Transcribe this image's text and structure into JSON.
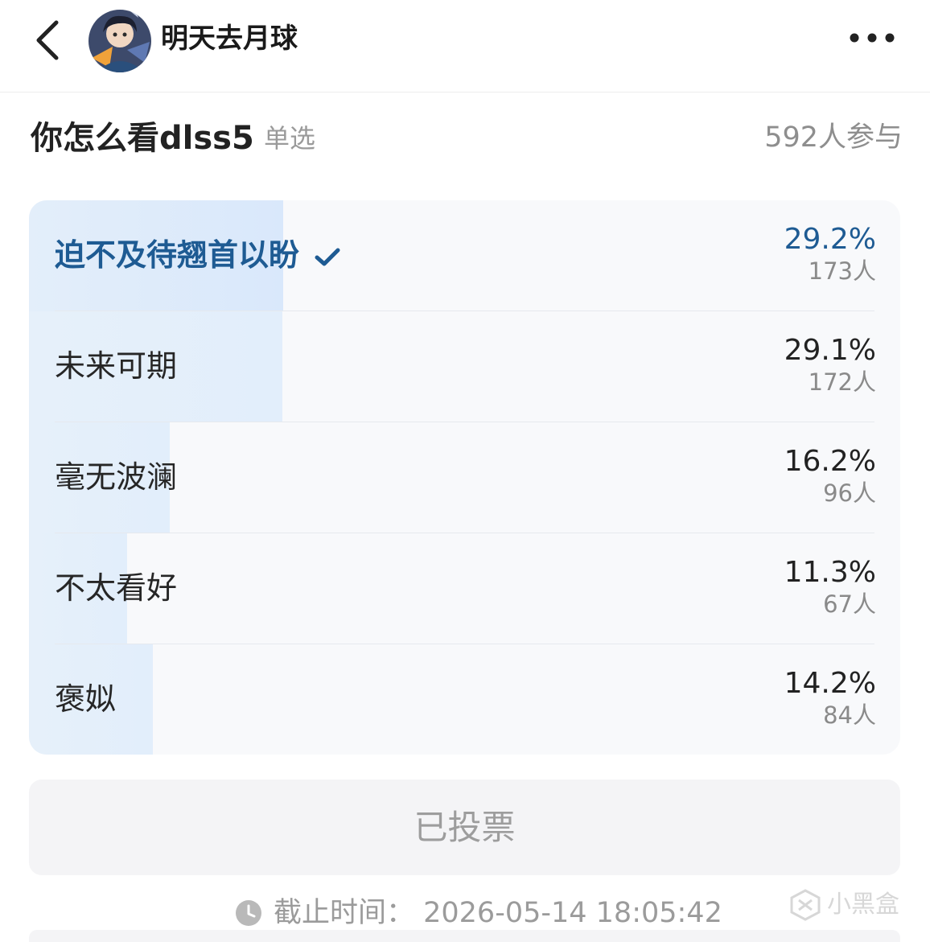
{
  "header": {
    "username": "明天去月球"
  },
  "poll": {
    "title": "你怎么看dlss5",
    "type": "单选",
    "participants": "592人参与",
    "options": [
      {
        "label": "迫不及待翘首以盼",
        "percent": "29.2%",
        "count": "173人",
        "fraction": 0.292,
        "selected": true
      },
      {
        "label": "未来可期",
        "percent": "29.1%",
        "count": "172人",
        "fraction": 0.291,
        "selected": false
      },
      {
        "label": "毫无波澜",
        "percent": "16.2%",
        "count": "96人",
        "fraction": 0.162,
        "selected": false
      },
      {
        "label": "不太看好",
        "percent": "11.3%",
        "count": "67人",
        "fraction": 0.113,
        "selected": false
      },
      {
        "label": "褒姒",
        "percent": "14.2%",
        "count": "84人",
        "fraction": 0.142,
        "selected": false
      }
    ],
    "voted_label": "已投票",
    "deadline": "截止时间：  2026-05-14 18:05:42"
  },
  "watermark": "小黑盒",
  "colors": {
    "accent": "#1e5b93",
    "bar": "#e3eefa",
    "card": "#f8f9fb"
  },
  "icons": [
    "back-icon",
    "more-icon",
    "check-icon",
    "clock-icon"
  ]
}
